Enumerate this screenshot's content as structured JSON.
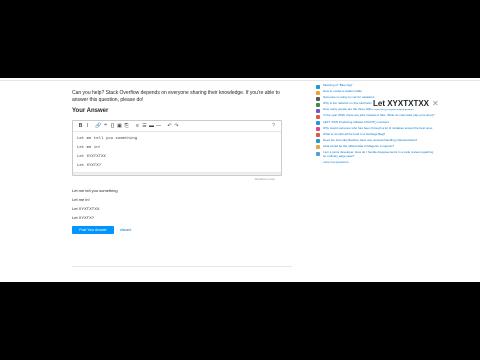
{
  "main": {
    "prompt": "Can you help? Stack Overflow depends on everyone sharing their knowledge. If you're able to answer this question, please do!",
    "your_answer": "Your Answer"
  },
  "editor": {
    "toolbar": {
      "bold": "B",
      "italic": "I",
      "link": "🔗",
      "quote": "❝",
      "code": "{}",
      "image": "▣",
      "snippet": "⎘",
      "ol": "≡",
      "ul": "☰",
      "heading": "▬",
      "hr": "—",
      "undo": "↶",
      "redo": "↷",
      "help": "?"
    },
    "text_lines": [
      "Let me tell you something",
      "Let me in!",
      "Let XYXTXTXX",
      "Let XYXTX?"
    ],
    "markdown_help": "Markdown help"
  },
  "preview": {
    "lines": [
      "Let me tell you something",
      "Let me in!",
      "Let XYXTXTXX",
      "Let XYXTX?"
    ]
  },
  "actions": {
    "post_label": "Post Your Answer",
    "discard_label": "discard"
  },
  "sidebar": {
    "items": [
      {
        "text": "Meaning of \"Blue bag\"",
        "color": "#1f9bd4"
      },
      {
        "text": "How to model a relation table",
        "color": "#e8a33a"
      },
      {
        "text": "Someone is using my car for vacations",
        "color": "#5a5a5a"
      },
      {
        "text": "Why is the reflector on this car/truck missing entirely?",
        "color": "#3e8e41"
      },
      {
        "text": "How many people are the three billion spending Digital Marketplace?",
        "color": "#7a4fc7"
      },
      {
        "text": "In the year 2099, these are jobs instead of hats. What do mammals play (one liner)?",
        "color": "#d95b4a"
      },
      {
        "text": "LEFT JOIN Producing Inflated COUNT() numbers",
        "color": "#1f9bd4"
      },
      {
        "text": "Why would someone who has been through a lot of mistakes accept the best ones",
        "color": "#d94a8c"
      },
      {
        "text": "What to do with all the food in a Garbage Bag?",
        "color": "#d95b4a"
      },
      {
        "text": "Does the Formula Machine have any unusual handling characteristics?",
        "color": "#1f9bd4"
      },
      {
        "text": "what would be the official data of Magento 2 support?",
        "color": "#e8a33a"
      },
      {
        "text": "I am a junior developer. How do I handle disagreements in a code review regarding an ordinary edge case?",
        "color": "#5a9bd4"
      }
    ],
    "more_label": "more hot questions"
  },
  "overlay": {
    "text": "Let XYXTXTXX",
    "close": "✕"
  }
}
